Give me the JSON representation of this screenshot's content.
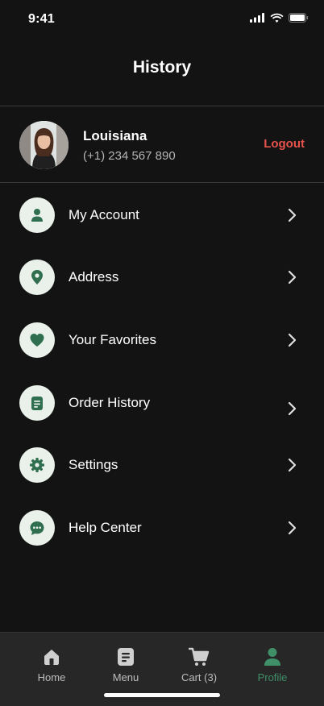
{
  "status": {
    "time": "9:41"
  },
  "header": {
    "title": "History"
  },
  "profile": {
    "name": "Louisiana",
    "phone": "(+1) 234 567 890",
    "logout_label": "Logout"
  },
  "menu": [
    {
      "label": "My Account",
      "icon": "user-icon"
    },
    {
      "label": "Address",
      "icon": "location-pin-icon"
    },
    {
      "label": "Your Favorites",
      "icon": "heart-icon"
    },
    {
      "label": "Order History",
      "icon": "document-icon"
    },
    {
      "label": "Settings",
      "icon": "gear-icon"
    },
    {
      "label": "Help Center",
      "icon": "chat-bubble-icon"
    }
  ],
  "tabs": [
    {
      "label": "Home",
      "icon": "home-icon"
    },
    {
      "label": "Menu",
      "icon": "menu-icon"
    },
    {
      "label": "Cart (3)",
      "icon": "cart-icon"
    },
    {
      "label": "Profile",
      "icon": "profile-icon",
      "active": true
    }
  ],
  "colors": {
    "background": "#131313",
    "accent": "#3f8f68",
    "logout": "#e5534b",
    "icon_bg": "#e9f1ea"
  }
}
